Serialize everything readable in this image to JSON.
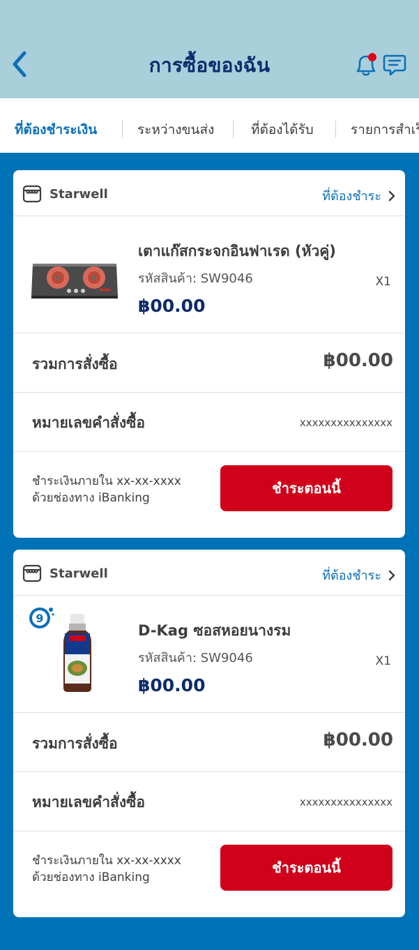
{
  "header": {
    "title": "การซื้อของฉัน",
    "back_icon": "chevron-left-icon",
    "bell_icon": "bell-icon",
    "chat_icon": "chat-icon",
    "notification_dot_color": "#e3001b"
  },
  "tabs": [
    {
      "label": "ที่ต้องชำระเงิน",
      "active": true
    },
    {
      "label": "ระหว่างขนส่ง",
      "active": false
    },
    {
      "label": "ที่ต้องได้รับ",
      "active": false
    },
    {
      "label": "รายการสำเร็จ",
      "active": false
    }
  ],
  "orders": [
    {
      "shop_name": "Starwell",
      "status": "ที่ต้องชำระ",
      "product_name": "เตาแก๊สกระจกอินฟาเรด (หัวคู่)",
      "sku": "รหัสสินค้า: SW9046",
      "price": "฿00.00",
      "qty": "X1",
      "total_label": "รวมการสั่งซื้อ",
      "total_value": "฿00.00",
      "order_label": "หมายเลขคำสั่งซื้อ",
      "order_value": "xxxxxxxxxxxxxxx",
      "pay_line1": "ชำระเงินภายใน  xx-xx-xxxx",
      "pay_line2": "ด้วยช่องทาง  iBanking",
      "pay_button": "ชำระตอนนี้"
    },
    {
      "shop_name": "Starwell",
      "status": "ที่ต้องชำระ",
      "product_name": "D-Kag ซอสหอยนางรม",
      "sku": "รหัสสินค้า: SW9046",
      "price": "฿00.00",
      "qty": "X1",
      "total_label": "รวมการสั่งซื้อ",
      "total_value": "฿00.00",
      "order_label": "หมายเลขคำสั่งซื้อ",
      "order_value": "xxxxxxxxxxxxxxx",
      "pay_line1": "ชำระเงินภายใน  xx-xx-xxxx",
      "pay_line2": "ด้วยช่องทาง  iBanking",
      "pay_button": "ชำระตอนนี้",
      "badge": "9"
    }
  ],
  "colors": {
    "header_bg": "#a9cfdb",
    "page_bg": "#0072b8",
    "title": "#0d2a6b",
    "accent_blue": "#0d6fb8",
    "pay_button": "#d0021b"
  }
}
